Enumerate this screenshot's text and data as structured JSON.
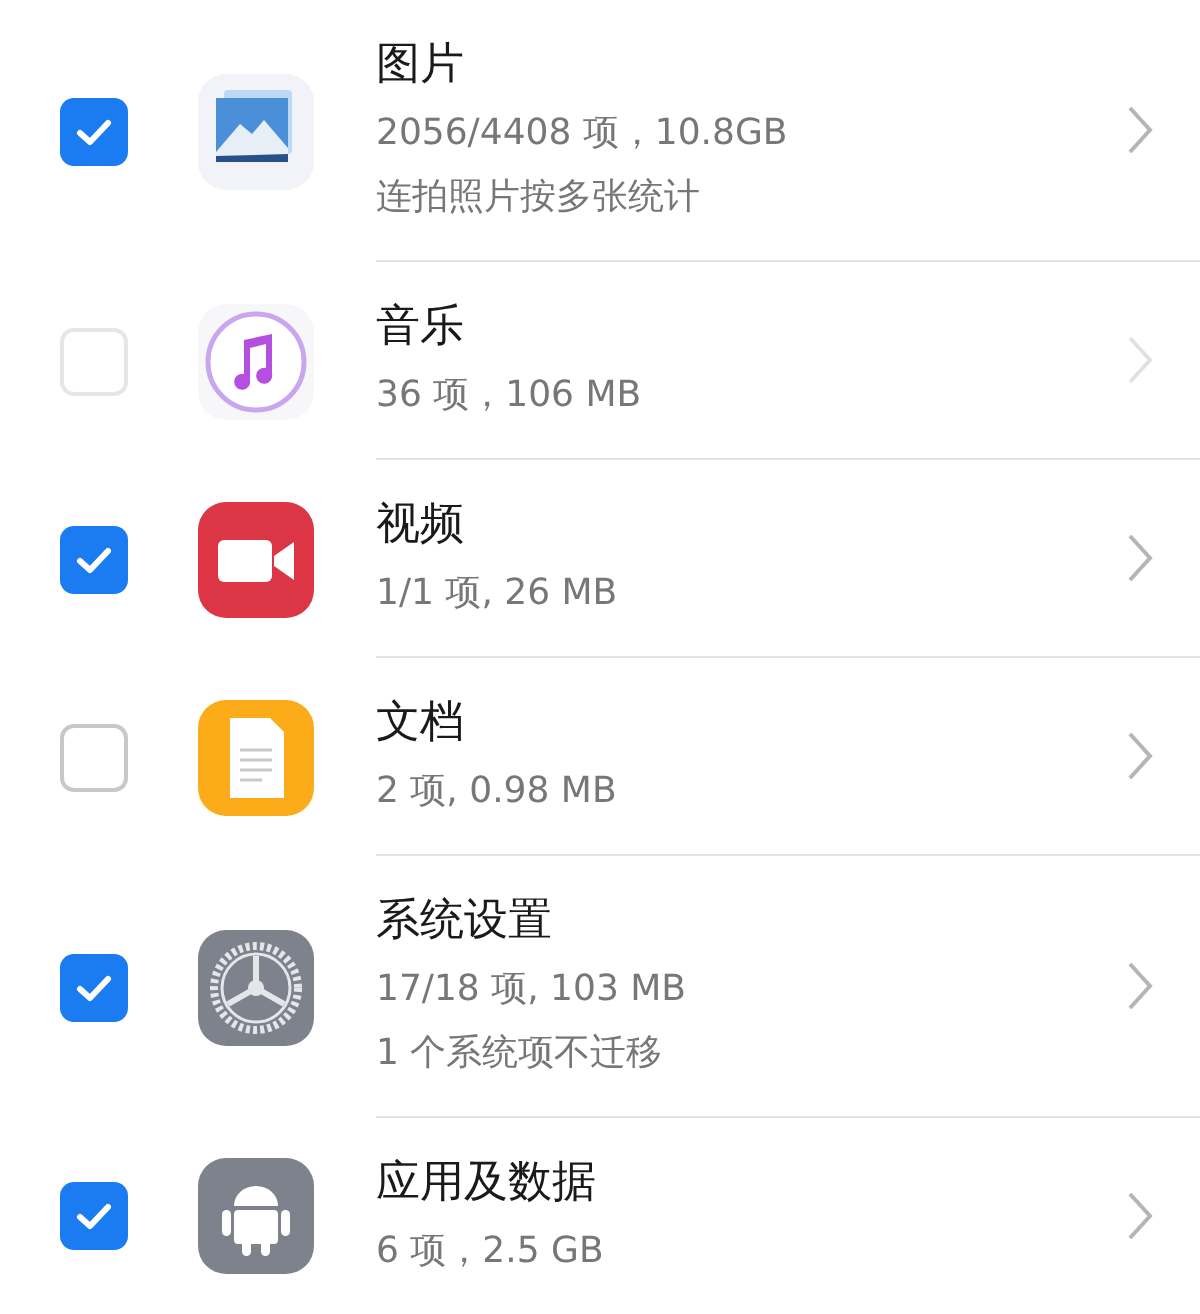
{
  "items": [
    {
      "kind": "photos",
      "checked": true,
      "title": "图片",
      "details": [
        "2056/4408 项，10.8GB",
        "连拍照片按多张统计"
      ],
      "disabled": false
    },
    {
      "kind": "music",
      "checked": false,
      "title": "音乐",
      "details": [
        "36 项，106 MB"
      ],
      "disabled": true
    },
    {
      "kind": "video",
      "checked": true,
      "title": "视频",
      "details": [
        "1/1 项, 26 MB"
      ],
      "disabled": false
    },
    {
      "kind": "document",
      "checked": false,
      "title": "文档",
      "details": [
        "2 项, 0.98 MB"
      ],
      "disabled": false
    },
    {
      "kind": "settings",
      "checked": true,
      "title": "系统设置",
      "details": [
        "17/18 项, 103 MB",
        "1 个系统项不迁移"
      ],
      "disabled": false
    },
    {
      "kind": "android",
      "checked": true,
      "title": "应用及数据",
      "details": [
        "6 项，2.5 GB"
      ],
      "disabled": false
    }
  ]
}
